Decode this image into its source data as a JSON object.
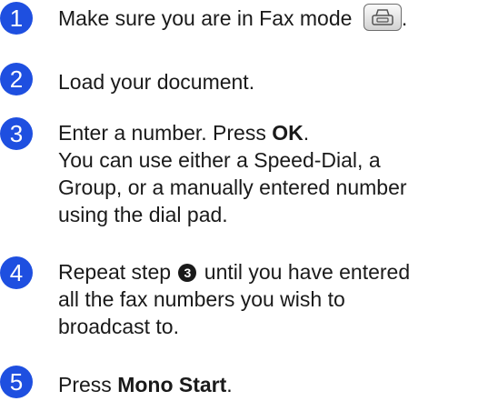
{
  "steps": [
    {
      "number": "1",
      "text": "Make sure you are in Fax mode",
      "trailing": ".",
      "key_icon": "fax-mode-key-icon"
    },
    {
      "number": "2",
      "text": "Load your document."
    },
    {
      "number": "3",
      "text_before": "Enter a number. Press ",
      "bold": "OK",
      "text_after": ".",
      "lines": [
        "You can use either a Speed-Dial, a",
        "Group, or a manually entered number",
        "using the dial pad."
      ]
    },
    {
      "number": "4",
      "text_before": "Repeat step ",
      "ref": "3",
      "text_after": " until you have entered",
      "lines": [
        "all the fax numbers you wish to",
        "broadcast to."
      ]
    },
    {
      "number": "5",
      "text_before": "Press ",
      "bold": "Mono Start",
      "text_after": "."
    }
  ],
  "colors": {
    "step_badge": "#1e4fe0",
    "text": "#1a1a1a"
  }
}
